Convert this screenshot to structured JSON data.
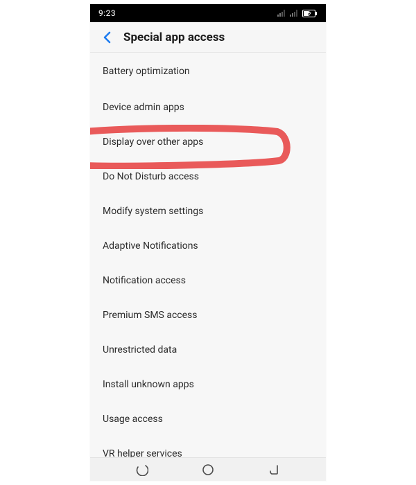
{
  "statusbar": {
    "time": "9:23"
  },
  "header": {
    "title": "Special app access"
  },
  "list": {
    "items": [
      {
        "id": "battery-optimization",
        "label": "Battery optimization"
      },
      {
        "id": "device-admin-apps",
        "label": "Device admin apps"
      },
      {
        "id": "display-over-apps",
        "label": "Display over other apps",
        "highlighted": true
      },
      {
        "id": "dnd-access",
        "label": "Do Not Disturb access"
      },
      {
        "id": "modify-system",
        "label": "Modify system settings"
      },
      {
        "id": "adaptive-notifications",
        "label": "Adaptive Notifications"
      },
      {
        "id": "notification-access",
        "label": "Notification access"
      },
      {
        "id": "premium-sms",
        "label": "Premium SMS access"
      },
      {
        "id": "unrestricted-data",
        "label": "Unrestricted data"
      },
      {
        "id": "install-unknown",
        "label": "Install unknown apps"
      },
      {
        "id": "usage-access",
        "label": "Usage access"
      },
      {
        "id": "vr-helper",
        "label": "VR helper services"
      }
    ]
  },
  "annotation": {
    "color": "#e95a5a"
  }
}
